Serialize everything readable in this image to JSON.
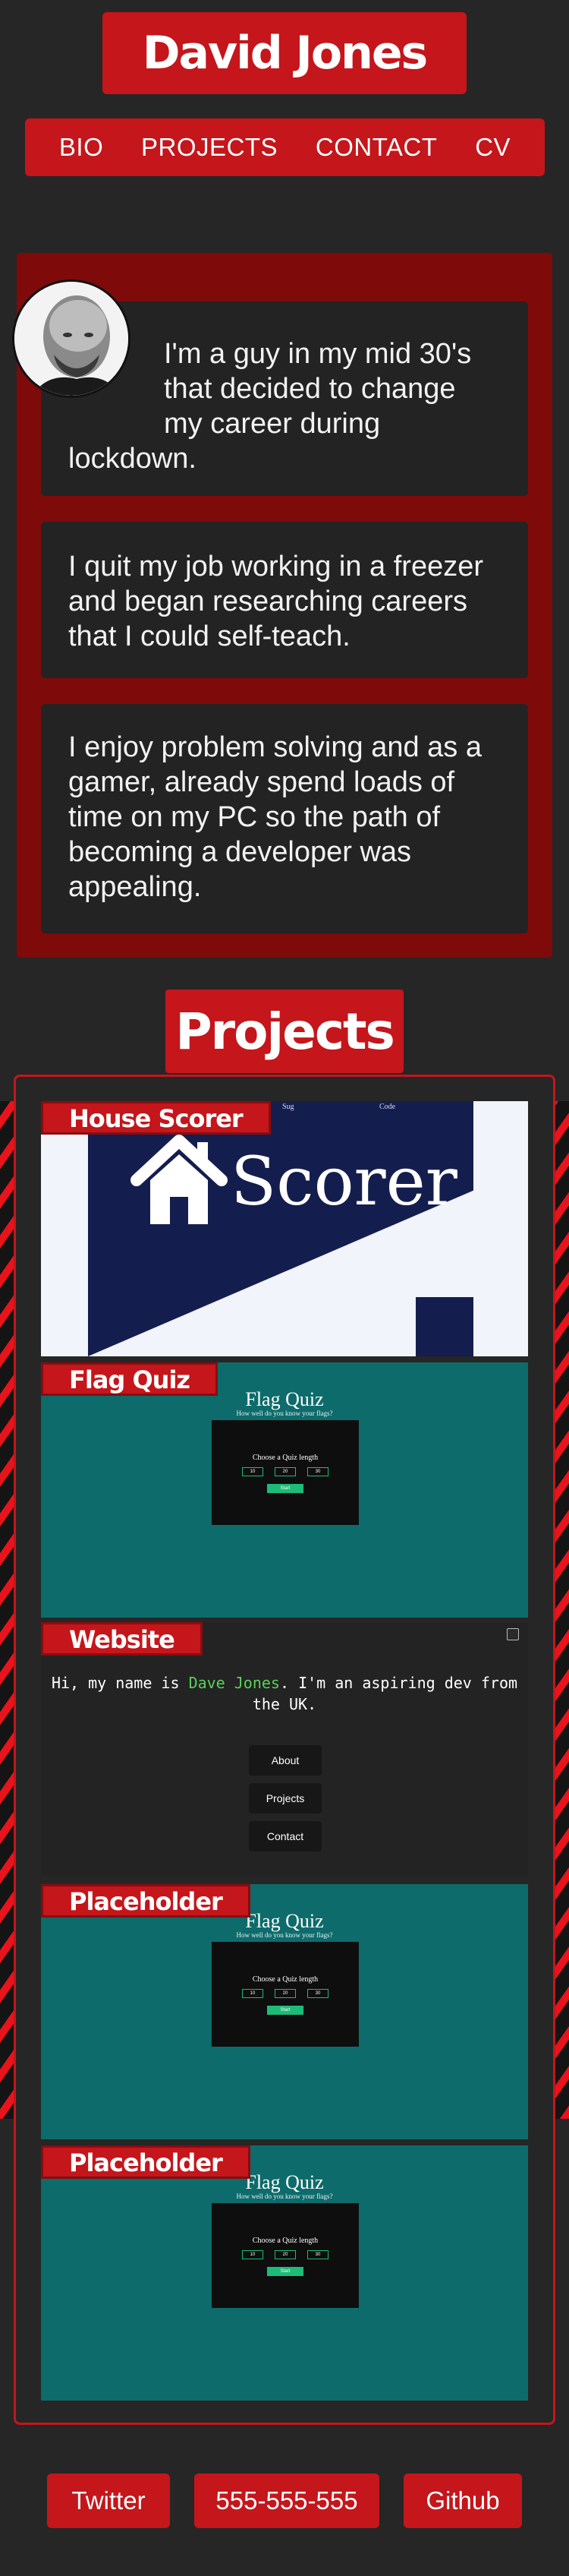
{
  "header": {
    "title": "David Jones"
  },
  "nav": {
    "items": [
      "BIO",
      "PROJECTS",
      "CONTACT",
      "CV"
    ]
  },
  "bio": {
    "cards": [
      {
        "first": "I'm a guy in my mid 30's that decided to change my career during",
        "last": "lockdown."
      },
      {
        "text": "I quit my job working in a freezer and began researching careers that I could self-teach."
      },
      {
        "text": "I enjoy problem solving and as a gamer, already spend loads of time on my PC so the path of becoming a developer was appealing."
      }
    ]
  },
  "projects": {
    "title": "Projects",
    "panels": [
      {
        "label": "House Scorer",
        "nav_left": "Sug",
        "nav_right": "Code",
        "logo_text": "Scorer"
      },
      {
        "label": "Flag Quiz",
        "quiz_title": "Flag Quiz",
        "quiz_subtitle": "How well do you know your flags?",
        "quiz_prompt": "Choose a Quiz length",
        "options": [
          "10",
          "20",
          "30"
        ],
        "start": "Start"
      },
      {
        "label": "Website",
        "intro_pre": "Hi, my name is ",
        "intro_name": "Dave Jones",
        "intro_post": ". I'm an aspiring dev from the UK.",
        "buttons": [
          "About",
          "Projects",
          "Contact"
        ]
      },
      {
        "label": "Placeholder",
        "quiz_title": "Flag Quiz",
        "quiz_subtitle": "How well do you know your flags?",
        "quiz_prompt": "Choose a Quiz length",
        "options": [
          "10",
          "20",
          "30"
        ],
        "start": "Start"
      },
      {
        "label": "Placeholder",
        "quiz_title": "Flag Quiz",
        "quiz_subtitle": "How well do you know your flags?",
        "quiz_prompt": "Choose a Quiz length",
        "options": [
          "10",
          "20",
          "30"
        ],
        "start": "Start"
      }
    ]
  },
  "footer": {
    "links": [
      "Twitter",
      "555-555-555",
      "Github"
    ]
  },
  "colors": {
    "accent": "#c4161b",
    "bio_bg": "#7e0a0a",
    "card_bg": "#232323",
    "page_bg": "#262626",
    "quiz_teal": "#0e6b6b",
    "navy": "#141e4e",
    "green": "#1dbb78",
    "name_green": "#5ad15a"
  },
  "icons": [
    "house-icon",
    "checkbox-icon"
  ]
}
